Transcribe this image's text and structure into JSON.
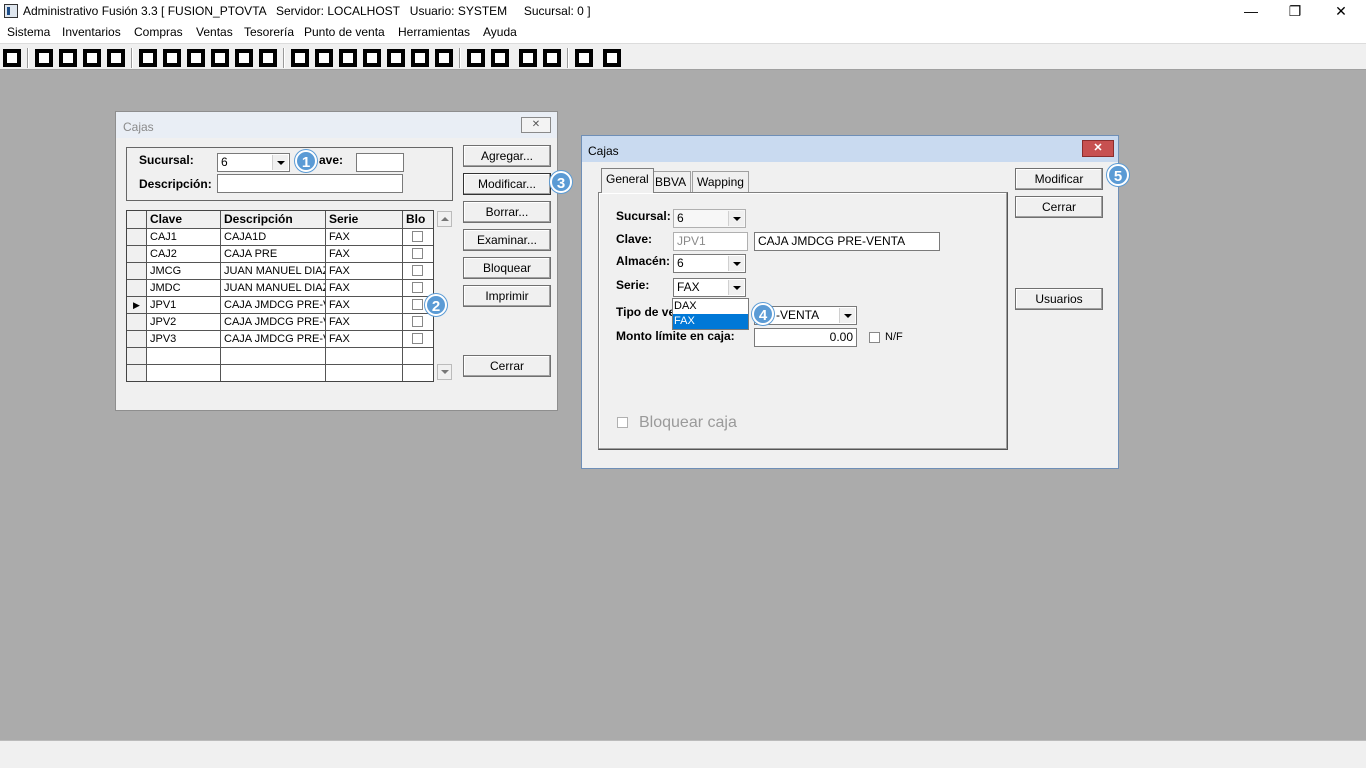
{
  "app": {
    "title": "Administrativo Fusión 3.3 [ FUSION_PTOVTA   Servidor: LOCALHOST   Usuario: SYSTEM     Sucursal: 0 ]"
  },
  "window_controls": {
    "minimize": "—",
    "restore": "❐",
    "close": "✕"
  },
  "menu": [
    "Sistema",
    "Inventarios",
    "Compras",
    "Ventas",
    "Tesorería",
    "Punto de venta",
    "Herramientas",
    "Ayuda"
  ],
  "toolbar_icons": [
    "calculator-icon",
    "copy-icon",
    "paste-icon",
    "swap-icon",
    "zoom-icon",
    "user-icon",
    "folder-icon",
    "print-preview-icon",
    "print-icon",
    "document-icon",
    "list-icon",
    "binoculars-icon",
    "card-icon",
    "export-icon",
    "add-icon",
    "money-icon",
    "report-icon",
    "doc-list-icon",
    "home-icon",
    "search-icon",
    "refresh-icon",
    "undo-icon",
    "back-icon",
    "help-icon"
  ],
  "cajas_list": {
    "title": "Cajas",
    "sucursal_label": "Sucursal:",
    "sucursal_value": "6",
    "clave_label": "ave:",
    "clave_value": "",
    "descripcion_label": "Descripción:",
    "descripcion_value": "",
    "columns": [
      "Clave",
      "Descripción",
      "Serie",
      "Blo"
    ],
    "rows": [
      {
        "clave": "CAJ1",
        "descripcion": "CAJA1D",
        "serie": "FAX"
      },
      {
        "clave": "CAJ2",
        "descripcion": "CAJA PRE",
        "serie": "FAX"
      },
      {
        "clave": "JMCG",
        "descripcion": "JUAN MANUEL DIAZ",
        "serie": "FAX"
      },
      {
        "clave": "JMDC",
        "descripcion": "JUAN MANUEL DIAZ",
        "serie": "FAX"
      },
      {
        "clave": "JPV1",
        "descripcion": "CAJA JMDCG PRE-VENTA",
        "serie": "FAX"
      },
      {
        "clave": "JPV2",
        "descripcion": "CAJA JMDCG PRE-VENTA",
        "serie": "FAX"
      },
      {
        "clave": "JPV3",
        "descripcion": "CAJA JMDCG PRE-VENTA",
        "serie": "FAX"
      }
    ],
    "selected_row_marker": "▶",
    "buttons": {
      "agregar": "Agregar...",
      "modificar": "Modificar...",
      "borrar": "Borrar...",
      "examinar": "Examinar...",
      "bloquear": "Bloquear",
      "imprimir": "Imprimir",
      "cerrar": "Cerrar"
    }
  },
  "cajas_edit": {
    "title": "Cajas",
    "close_glyph": "✕",
    "tabs": [
      "General",
      "BBVA",
      "Wapping"
    ],
    "sucursal_label": "Sucursal:",
    "sucursal_value": "6",
    "clave_label": "Clave:",
    "clave_value": "JPV1",
    "clave_desc_value": "CAJA JMDCG PRE-VENTA",
    "almacen_label": "Almacén:",
    "almacen_value": "6",
    "serie_label": "Serie:",
    "serie_value": "FAX",
    "serie_options": [
      "DAX",
      "FAX"
    ],
    "tipo_label": "Tipo de ve",
    "tipo_value": "-VENTA",
    "monto_label": "Monto límite en caja:",
    "monto_value": "0.00",
    "nf_label": "N/F",
    "bloquear_label": "Bloquear caja",
    "buttons": {
      "modificar": "Modificar",
      "cerrar": "Cerrar",
      "usuarios": "Usuarios"
    }
  },
  "badges": [
    "1",
    "2",
    "3",
    "4",
    "5"
  ],
  "colors": {
    "badge": "#5b9bd5",
    "selection": "#0078d7",
    "desktop": "#ababab"
  }
}
